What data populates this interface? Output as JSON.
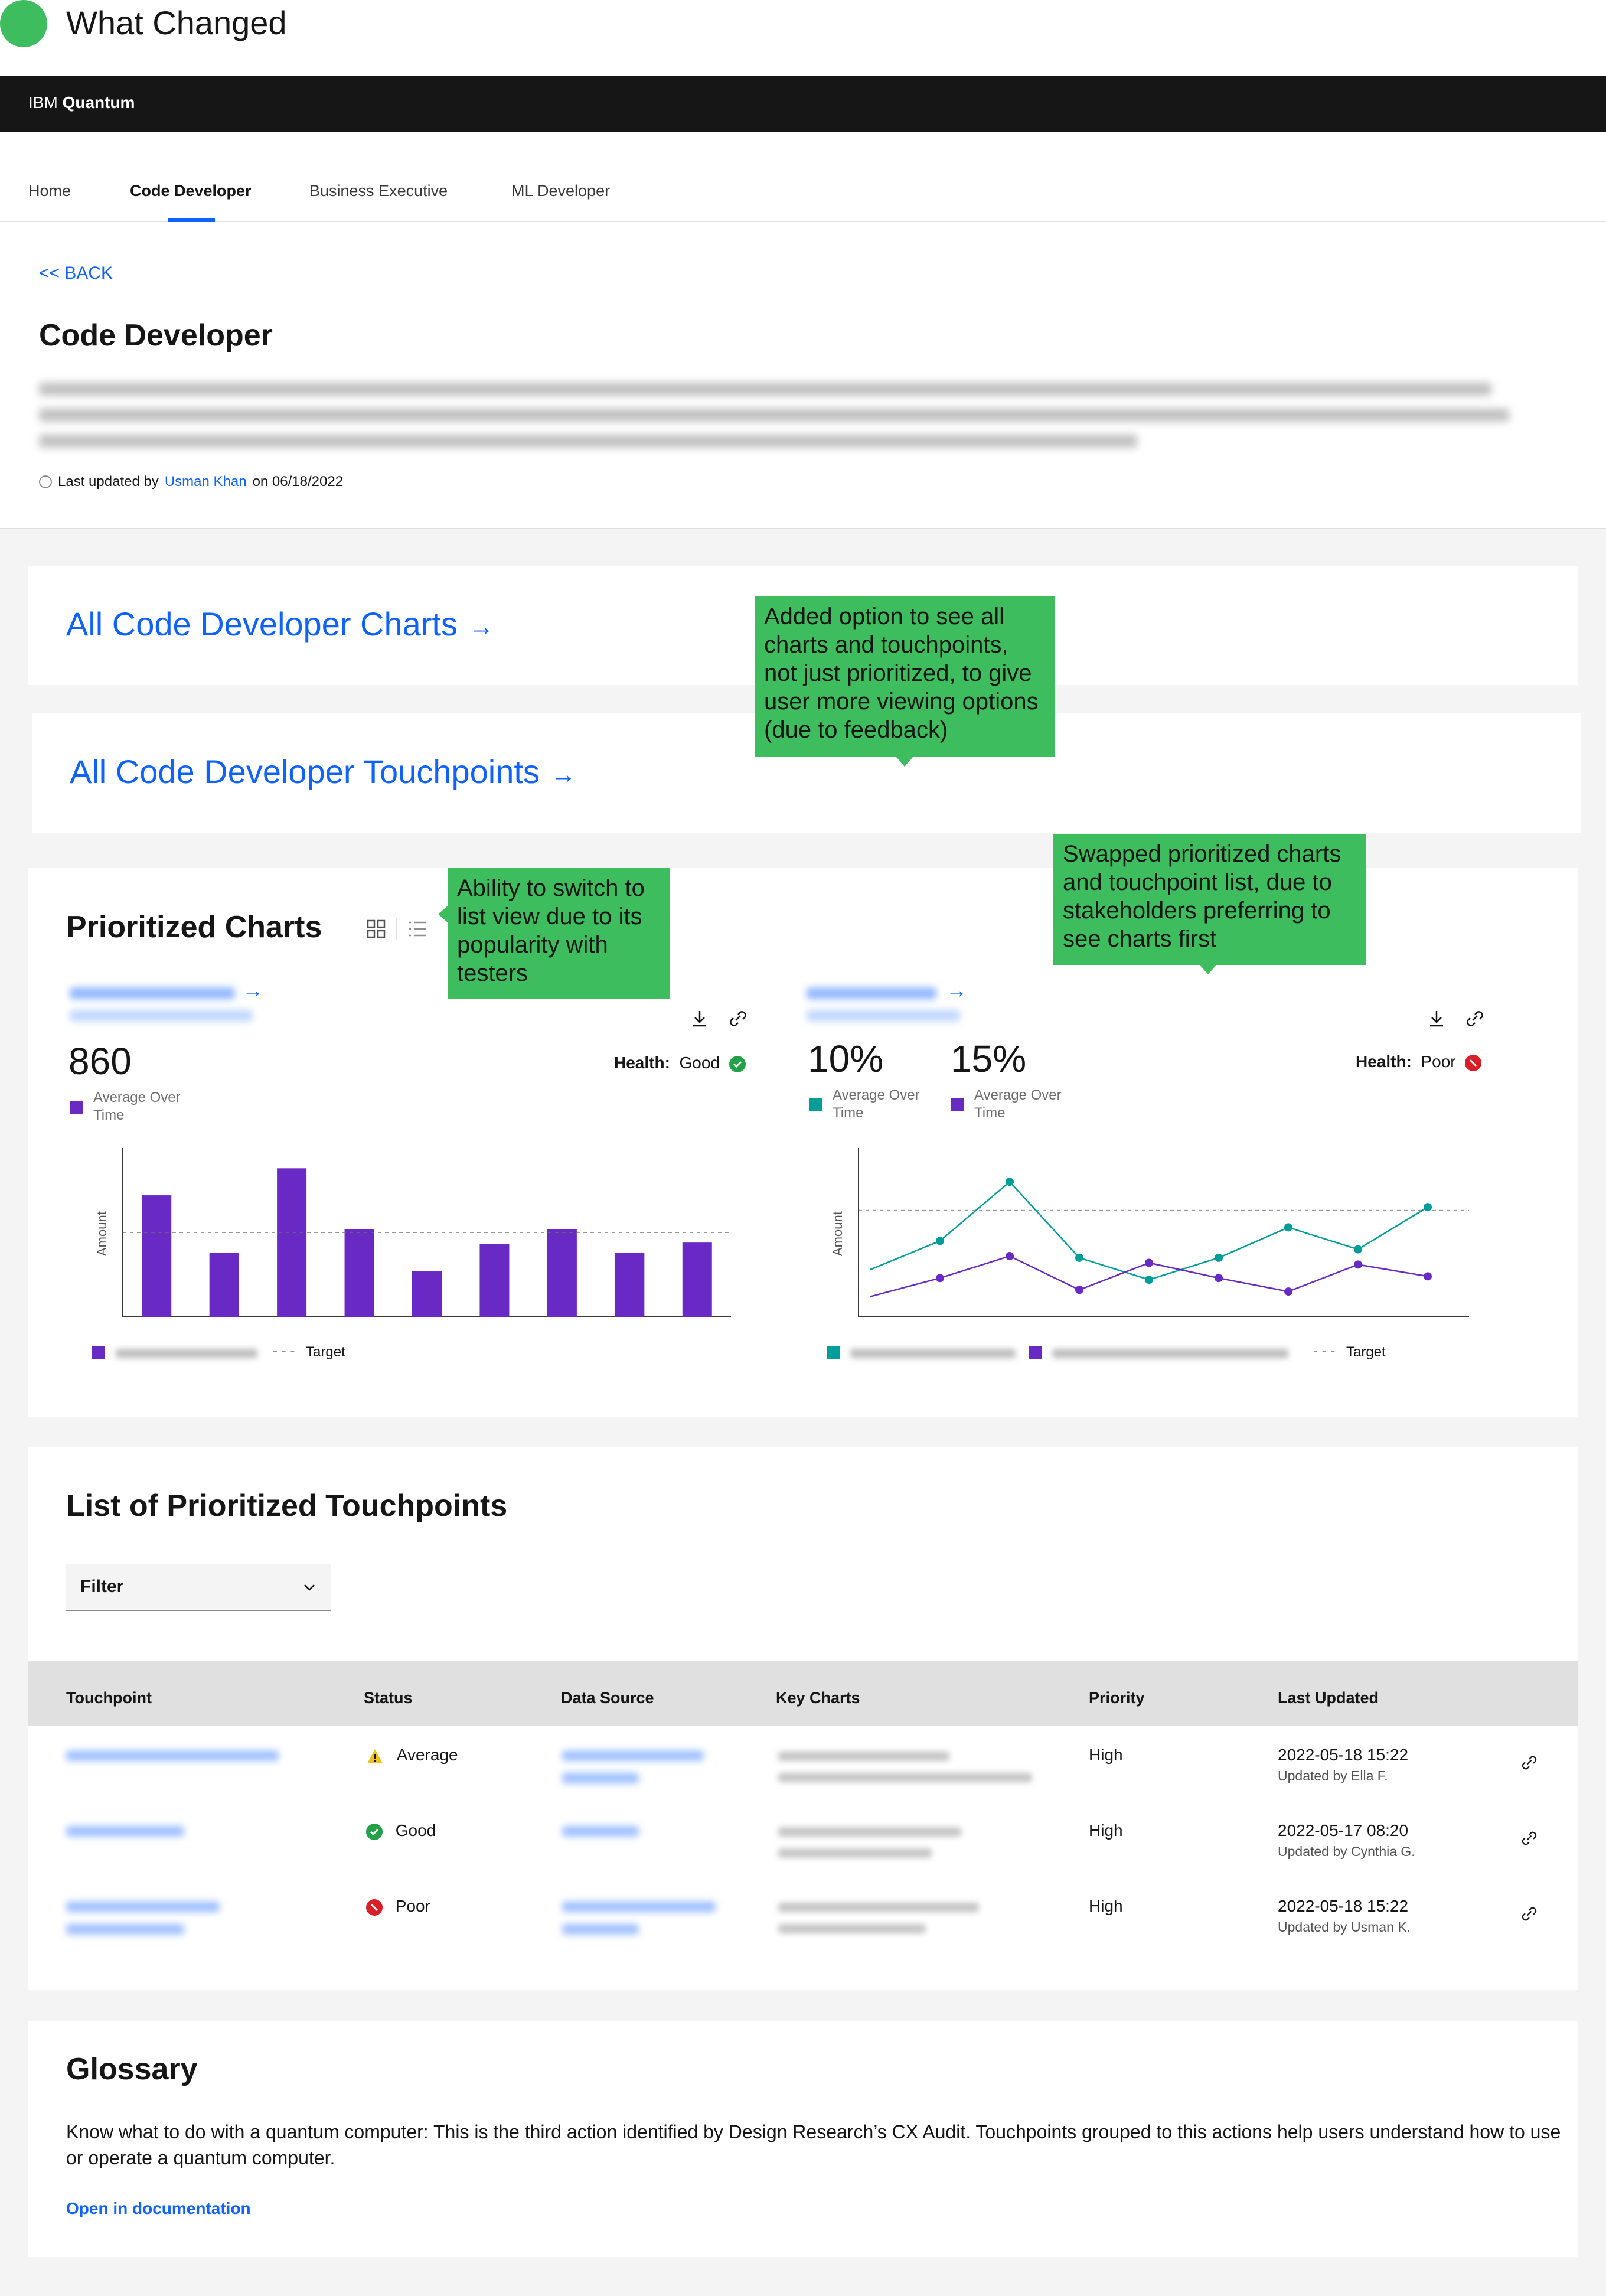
{
  "annotation_header": {
    "title": "What Changed"
  },
  "app": {
    "brand_prefix": "IBM",
    "brand_name": "Quantum"
  },
  "tabs": [
    {
      "label": "Home"
    },
    {
      "label": "Code Developer"
    },
    {
      "label": "Business Executive"
    },
    {
      "label": "ML Developer"
    }
  ],
  "page": {
    "back_label": "<< BACK",
    "title": "Code Developer",
    "updated_prefix": "Last updated by",
    "updated_user": "Usman Khan",
    "updated_on": "on 06/18/2022"
  },
  "links": {
    "all_charts": "All Code Developer Charts",
    "all_touchpoints": "All Code Developer Touchpoints",
    "arrow": "→"
  },
  "callouts": {
    "options": "Added option to see all charts and touchpoints, not just prioritized, to give user more viewing options (due to feedback)",
    "list_view": "Ability to switch to list view due to its popularity with testers",
    "swapped": "Swapped prioritized charts and touchpoint list, due to stakeholders preferring to see charts first"
  },
  "prioritized_charts": {
    "title": "Prioritized Charts",
    "grid_icon": "grid-view-icon",
    "list_icon": "list-view-icon",
    "arrow": "→",
    "health_label": "Health:",
    "download_icon": "download-icon",
    "link_icon": "link-icon"
  },
  "chart_data": [
    {
      "type": "bar",
      "kpis": [
        {
          "value": "860",
          "label": "Average Over Time",
          "color": "#6929c4"
        }
      ],
      "health": "Good",
      "health_color": "#24a148",
      "ylabel": "Amount",
      "categories": [
        "",
        "",
        "",
        "",
        "",
        "",
        "",
        "",
        ""
      ],
      "series": [
        {
          "values": [
            72,
            38,
            88,
            52,
            27,
            43,
            52,
            38,
            44
          ],
          "color": "#6929c4"
        }
      ],
      "target": 50,
      "ylim": [
        0,
        100
      ],
      "legend": {
        "target_label": "Target"
      }
    },
    {
      "type": "line",
      "kpis": [
        {
          "value": "10%",
          "label": "Average Over Time",
          "color": "#009d9a"
        },
        {
          "value": "15%",
          "label": "Average Over Time",
          "color": "#6929c4"
        }
      ],
      "health": "Poor",
      "health_color": "#da1e28",
      "ylabel": "Amount",
      "x": [
        0,
        1,
        2,
        3,
        4,
        5,
        6,
        7,
        8,
        9
      ],
      "series": [
        {
          "values": [
            28,
            45,
            80,
            35,
            22,
            35,
            53,
            40,
            65
          ],
          "color": "#009d9a"
        },
        {
          "values": [
            12,
            23,
            36,
            16,
            32,
            23,
            15,
            31,
            24
          ],
          "color": "#6929c4"
        }
      ],
      "target": 63,
      "ylim": [
        0,
        100
      ],
      "legend": {
        "target_label": "Target"
      }
    }
  ],
  "touchpoints": {
    "title": "List of Prioritized Touchpoints",
    "filter_label": "Filter",
    "columns": [
      "Touchpoint",
      "Status",
      "Data Source",
      "Key Charts",
      "Priority",
      "Last Updated"
    ],
    "rows": [
      {
        "status": "Average",
        "status_color": "#f1c21b",
        "priority": "High",
        "updated": "2022-05-18 15:22",
        "updated_by": "Updated by Ella F."
      },
      {
        "status": "Good",
        "status_color": "#24a148",
        "priority": "High",
        "updated": "2022-05-17 08:20",
        "updated_by": "Updated by Cynthia G."
      },
      {
        "status": "Poor",
        "status_color": "#da1e28",
        "priority": "High",
        "updated": "2022-05-18 15:22",
        "updated_by": "Updated by Usman K."
      }
    ]
  },
  "glossary": {
    "title": "Glossary",
    "text": "Know what to do with a quantum computer:  This is the third action identified by Design Research’s CX Audit.  Touchpoints grouped to this actions help users understand how to use or operate a quantum computer.",
    "link": "Open in documentation"
  }
}
